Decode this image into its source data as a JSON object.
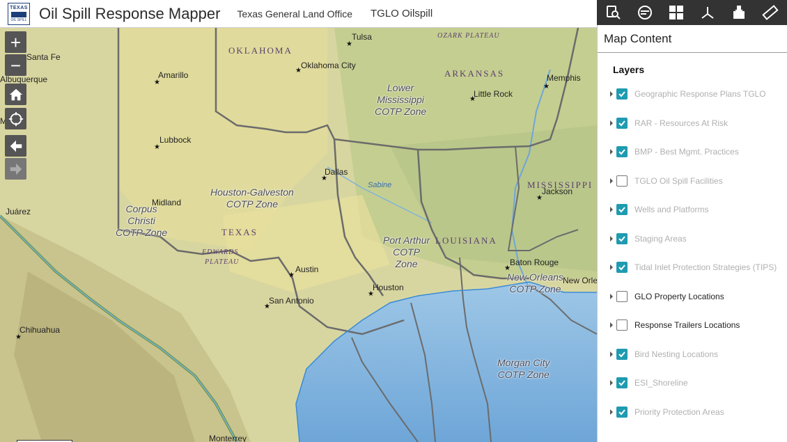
{
  "header": {
    "app_title": "Oil Spill Response Mapper",
    "org_link": "Texas General Land Office",
    "tglo_link": "TGLO Oilspill",
    "logo": {
      "line1": "TEXAS",
      "line3": "OIL SPILL"
    }
  },
  "toolbar": {
    "tools": [
      {
        "icon": "search-list-icon"
      },
      {
        "icon": "map-layers-icon"
      },
      {
        "icon": "grid-icon"
      },
      {
        "icon": "coordinate-axes-icon"
      },
      {
        "icon": "download-icon"
      },
      {
        "icon": "ruler-icon"
      }
    ]
  },
  "panel": {
    "title": "Map Content",
    "layers_heading": "Layers",
    "layers": [
      {
        "name": "Geographic Response Plans TGLO",
        "checked": true,
        "active": false
      },
      {
        "name": "RAR - Resources At Risk",
        "checked": true,
        "active": false
      },
      {
        "name": "BMP - Best Mgmt. Practices",
        "checked": true,
        "active": false
      },
      {
        "name": "TGLO Oil Spill Facilities",
        "checked": false,
        "active": false
      },
      {
        "name": "Wells and Platforms",
        "checked": true,
        "active": false
      },
      {
        "name": "Staging Areas",
        "checked": true,
        "active": false
      },
      {
        "name": "Tidal Inlet Protection Strategies (TIPS)",
        "checked": true,
        "active": false
      },
      {
        "name": "GLO Property Locations",
        "checked": false,
        "active": true
      },
      {
        "name": "Response Trailers Locations",
        "checked": false,
        "active": true
      },
      {
        "name": "Bird Nesting Locations",
        "checked": true,
        "active": false
      },
      {
        "name": "ESI_Shoreline",
        "checked": true,
        "active": false
      },
      {
        "name": "Priority Protection Areas",
        "checked": true,
        "active": false
      }
    ]
  },
  "map_controls": {
    "zoom_in": "+",
    "zoom_out": "−"
  },
  "map": {
    "cities": [
      "Tulsa",
      "Santa Fe",
      "Albuquerque",
      "Amarillo",
      "Oklahoma City",
      "Memphis",
      "Little Rock",
      "Lubbock",
      "Dallas",
      "Jackson",
      "Midland",
      "Juárez",
      "Austin",
      "Baton Rouge",
      "New Orleans",
      "Houston",
      "San Antonio",
      "Chihuahua",
      "Monterrey",
      "Mexico"
    ],
    "states": [
      "OKLAHOMA",
      "ARKANSAS",
      "TEXAS",
      "MISSISSIPPI",
      "LOUISIANA"
    ],
    "terrain": [
      "OZARK PLATEAU",
      "EDWARDS",
      "PLATEAU"
    ],
    "rivers": [
      "Sabine"
    ],
    "zones": [
      {
        "lines": [
          "Lower",
          "Mississippi",
          "COTP Zone"
        ]
      },
      {
        "lines": [
          "Houston-Galveston",
          "COTP Zone"
        ]
      },
      {
        "lines": [
          "Corpus",
          "Christi",
          "COTP Zone"
        ]
      },
      {
        "lines": [
          "Port Arthur",
          "COTP",
          "Zone"
        ]
      },
      {
        "lines": [
          "New Orleans",
          "COTP Zone"
        ]
      },
      {
        "lines": [
          "Morgan City",
          "COTP Zone"
        ]
      }
    ]
  }
}
